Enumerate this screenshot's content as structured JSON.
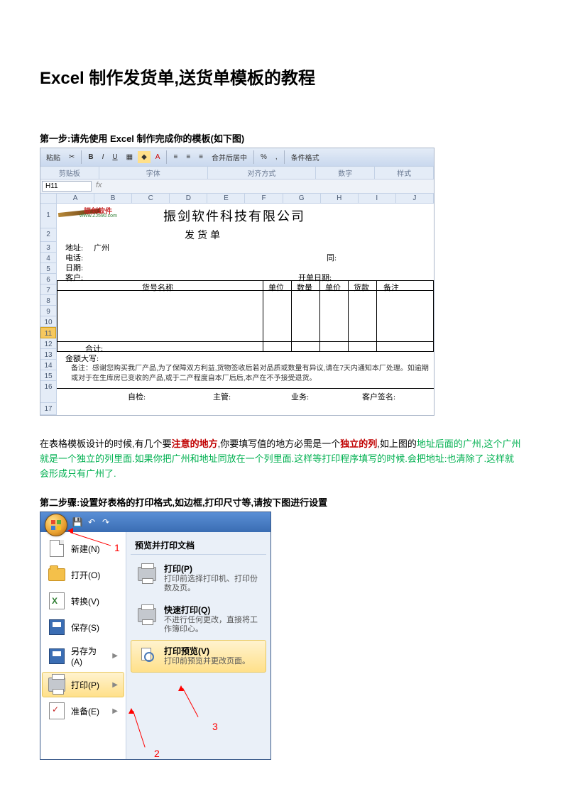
{
  "title": "Excel 制作发货单,送货单模板的教程",
  "step1": "第一步:请先使用 Excel 制作完成你的模板(如下图)",
  "step2": "第二步骤:设置好表格的打印格式,如边框,打印尺寸等,请按下图进行设置",
  "excel": {
    "ribbon": {
      "paste_label": "粘贴",
      "clipboard": "剪贴板",
      "font_group": "字体",
      "align_group": "对齐方式",
      "number_group": "数字",
      "merge_label": "合并后居中",
      "cond_fmt": "条件格式",
      "styles": "样式"
    },
    "namebox": "H11",
    "columns": [
      "A",
      "B",
      "C",
      "D",
      "E",
      "F",
      "G",
      "H",
      "I",
      "J"
    ],
    "rows": [
      "1",
      "2",
      "3",
      "4",
      "5",
      "6",
      "7",
      "8",
      "9",
      "10",
      "11",
      "12",
      "13",
      "14",
      "15",
      "16",
      "17"
    ],
    "logo_red": "振剑软件",
    "logo_green": "wWw.ZJ590.com",
    "company": "振剑软件科技有限公司",
    "doc_title": "发货单",
    "labels": {
      "addr": "地址:",
      "addr_val": "广州",
      "tel": "电话:",
      "date": "日期:",
      "fax": "同:",
      "cust": "客户:",
      "open_date": "开单日期:"
    },
    "headers": [
      "货号名称",
      "单位",
      "数量",
      "单价",
      "货款",
      "备注"
    ],
    "sum": "合计:",
    "amount_cn": "金额大写:",
    "footnote": "备注：感谢您购买我厂产品,为了保障双方利益,货物签收后若对品质或数量有异议,请在7天内通知本厂处理。如逾期或对于在生库房已变收的产品,或于二产程度自本厂后后,本产在不予接受退货。",
    "sig": {
      "f1": "自检:",
      "f2": "主管:",
      "f3": "业务:",
      "f4": "客户签名:"
    }
  },
  "para_parts": {
    "t1": "在表格模板设计的时候,有几个要",
    "t2": "注意的地方",
    "t3": ",你要填写值的地方必需是一个",
    "t4": "独立的列",
    "t5": ",如上图的",
    "t6": "地址后面的广州,这个广州就是一个独立的列里面.如果你把广州和地址同放在一个列里面.这样等打印程序填写的时候.会把地址:也清除了.这样就会形成只有广州了.",
    "dummy": ""
  },
  "menu": {
    "preview_title": "预览并打印文档",
    "items": {
      "new": "新建(N)",
      "open": "打开(O)",
      "convert": "转换(V)",
      "save": "保存(S)",
      "saveas": "另存为(A)",
      "print": "打印(P)",
      "prepare": "准备(E)"
    },
    "sub": {
      "print_t": "打印(P)",
      "print_d": "打印前选择打印机、打印份数及页。",
      "quick_t": "快速打印(Q)",
      "quick_d": "不进行任何更改，直接将工作簿印心。",
      "preview_t": "打印预览(V)",
      "preview_d": "打印前预览并更改页面。"
    }
  },
  "annotations": {
    "a1": "1",
    "a2": "2",
    "a3": "3"
  }
}
